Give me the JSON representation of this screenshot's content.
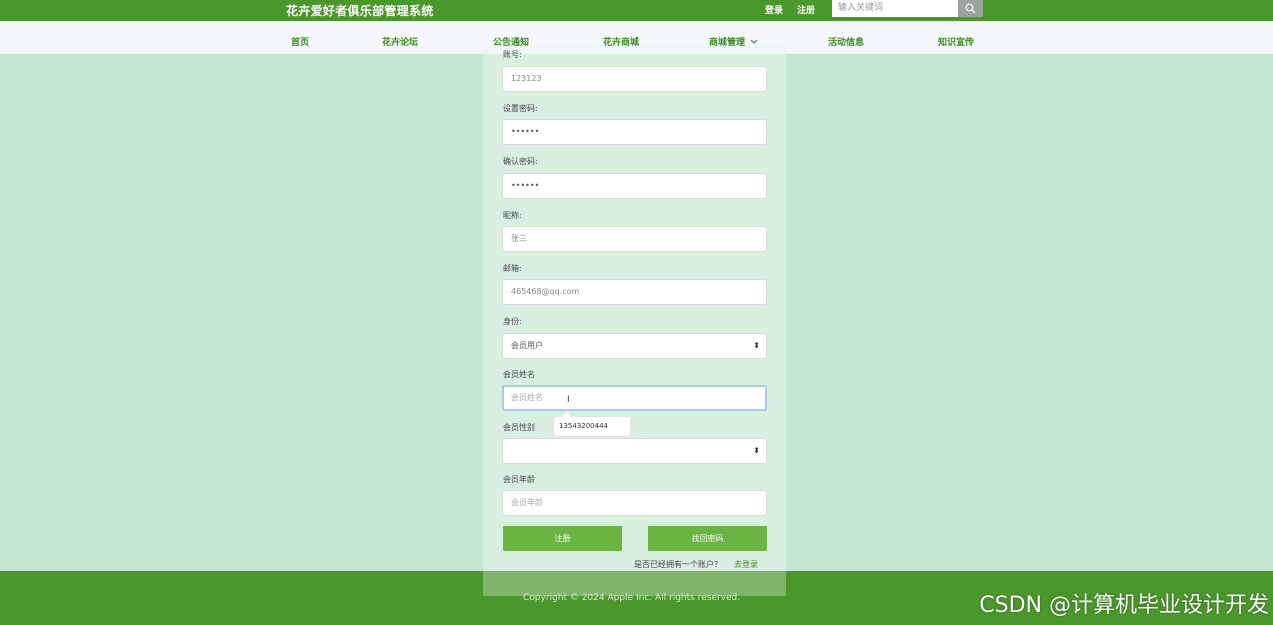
{
  "header": {
    "site_title": "花卉爱好者俱乐部管理系统",
    "login": "登录",
    "register": "注册",
    "search_placeholder": "输入关键词"
  },
  "nav": {
    "items": [
      "首页",
      "花卉论坛",
      "公告通知",
      "花卉商城",
      "商城管理",
      "活动信息",
      "知识宣传"
    ]
  },
  "form": {
    "account_label": "账号:",
    "account_value": "123123",
    "password_label": "设置密码:",
    "password_value": "••••••",
    "confirm_label": "确认密码:",
    "confirm_value": "••••••",
    "nickname_label": "昵称:",
    "nickname_value": "张三",
    "email_label": "邮箱:",
    "email_value": "465468@qq.com",
    "role_label": "身份:",
    "role_value": "会员用户",
    "member_name_label": "会员姓名",
    "member_name_placeholder": "会员姓名",
    "autocomplete_suggestion": "13543200444",
    "member_gender_label": "会员性别",
    "member_gender_value": "",
    "member_age_label": "会员年龄",
    "member_age_placeholder": "会员年龄",
    "register_button": "注册",
    "recover_button": "找回密码",
    "have_account_text": "是否已经拥有一个账户?",
    "go_login_link": "去登录"
  },
  "footer": {
    "copyright": "Copyright © 2024 Apple Inc. All rights reserved."
  },
  "watermark": "CSDN @计算机毕业设计开发",
  "colors": {
    "primary": "#4a972b",
    "button": "#6ab443",
    "page_bg": "#c4e8cf"
  }
}
